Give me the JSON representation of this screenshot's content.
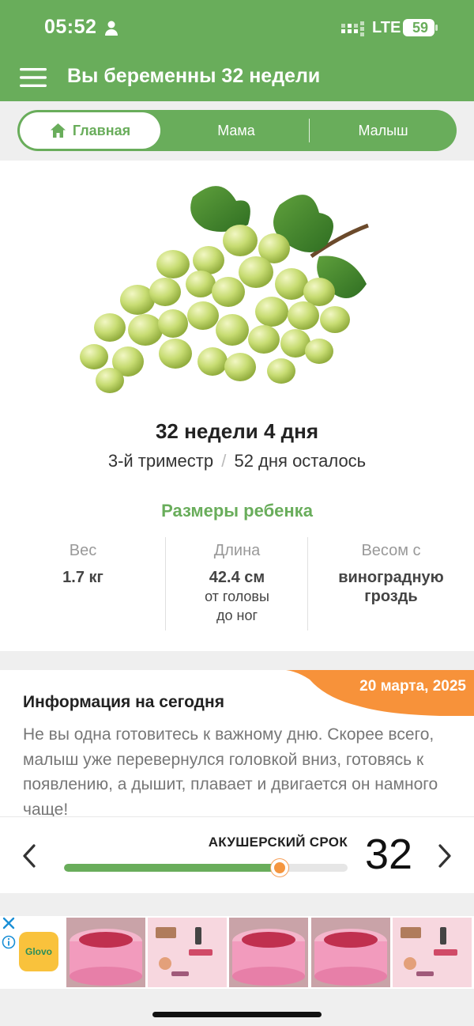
{
  "status": {
    "time": "05:52",
    "network": "LTE",
    "battery": "59"
  },
  "header": {
    "title": "Вы беременны 32 недели"
  },
  "tabs": [
    {
      "label": "Главная",
      "active": true
    },
    {
      "label": "Мама",
      "active": false
    },
    {
      "label": "Малыш",
      "active": false
    }
  ],
  "summary": {
    "week_title": "32 недели 4 дня",
    "trimester": "3-й триместр",
    "separator": "/",
    "days_left": "52 дня осталось",
    "sizes_title": "Размеры ребенка"
  },
  "metrics": [
    {
      "label": "Вес",
      "value": "1.7 кг"
    },
    {
      "label": "Длина",
      "value": "42.4 см",
      "sub1": "от головы",
      "sub2": "до ног"
    },
    {
      "label": "Весом с",
      "value1": "виноградную",
      "value2": "гроздь"
    }
  ],
  "info": {
    "date": "20 марта, 2025",
    "title": "Информация на сегодня",
    "body": "Не вы одна готовитесь к важному дню. Скорее всего, малыш уже перевернулся головкой вниз, готовясь к появлению, а дышит, плавает и двигается он намного чаще!"
  },
  "progress": {
    "label": "АКУШЕРСКИЙ СРОК",
    "week": "32",
    "fraction": 0.76
  },
  "ad": {
    "brand": "Glovo"
  },
  "colors": {
    "brand_green": "#69ad5b",
    "accent_orange": "#f7923a"
  },
  "icons": [
    "person-icon",
    "signal-icon",
    "battery-icon",
    "menu-icon",
    "home-icon",
    "chevron-left-icon",
    "chevron-right-icon",
    "close-icon",
    "info-icon"
  ]
}
